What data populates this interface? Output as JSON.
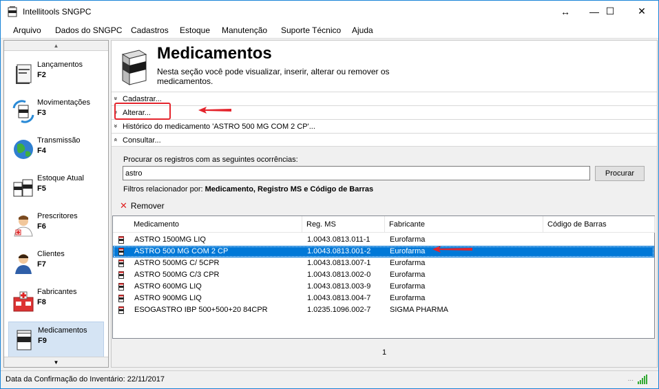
{
  "window": {
    "title": "Intellitools SNGPC",
    "controls": {
      "resize": "↔",
      "minimize": "—",
      "maximize": "☐",
      "close": "✕"
    }
  },
  "menu": [
    "Arquivo",
    "Dados do SNGPC",
    "Cadastros",
    "Estoque",
    "Manutenção",
    "Suporte Técnico",
    "Ajuda"
  ],
  "sidebar": {
    "items": [
      {
        "label": "Lançamentos",
        "key": "F2",
        "icon": "ledger-book-icon"
      },
      {
        "label": "Movimentações",
        "key": "F3",
        "icon": "transfer-arrows-icon"
      },
      {
        "label": "Transmissão",
        "key": "F4",
        "icon": "globe-icon"
      },
      {
        "label": "Estoque Atual",
        "key": "F5",
        "icon": "boxes-icon"
      },
      {
        "label": "Prescritores",
        "key": "F6",
        "icon": "doctor-icon"
      },
      {
        "label": "Clientes",
        "key": "F7",
        "icon": "person-icon"
      },
      {
        "label": "Fabricantes",
        "key": "F8",
        "icon": "factory-icon"
      },
      {
        "label": "Medicamentos",
        "key": "F9",
        "icon": "medicine-box-icon"
      }
    ],
    "scroll_up": "▲",
    "scroll_down": "▼"
  },
  "header": {
    "title": "Medicamentos",
    "description": "Nesta seção você pode visualizar, inserir, alterar ou remover os medicamentos."
  },
  "sections": [
    {
      "label": "Cadastrar...",
      "chevron": "»"
    },
    {
      "label": "Alterar...",
      "chevron": "»"
    },
    {
      "label": "Histórico do medicamento 'ASTRO 500 MG COM 2 CP'...",
      "chevron": "»"
    },
    {
      "label": "Consultar...",
      "chevron": "«"
    }
  ],
  "search": {
    "label": "Procurar os registros com as seguintes ocorrências:",
    "value": "astro",
    "button": "Procurar",
    "filters_prefix": "Filtros relacionador por:",
    "filters_value": "Medicamento, Registro MS e Código de Barras"
  },
  "toolbar": {
    "remove": "Remover"
  },
  "table": {
    "columns": [
      "Medicamento",
      "Reg. MS",
      "Fabricante",
      "Código de Barras"
    ],
    "rows": [
      {
        "medicamento": "ASTRO 1500MG LIQ",
        "reg_ms": "1.0043.0813.011-1",
        "fabricante": "Eurofarma",
        "codigo": ""
      },
      {
        "medicamento": "ASTRO 500 MG COM 2 CP",
        "reg_ms": "1.0043.0813.001-2",
        "fabricante": "Eurofarma",
        "codigo": ""
      },
      {
        "medicamento": "ASTRO 500MG C/ 5CPR",
        "reg_ms": "1.0043.0813.007-1",
        "fabricante": "Eurofarma",
        "codigo": ""
      },
      {
        "medicamento": "ASTRO 500MG C/3 CPR",
        "reg_ms": "1.0043.0813.002-0",
        "fabricante": "Eurofarma",
        "codigo": ""
      },
      {
        "medicamento": "ASTRO 600MG LIQ",
        "reg_ms": "1.0043.0813.003-9",
        "fabricante": "Eurofarma",
        "codigo": ""
      },
      {
        "medicamento": "ASTRO 900MG LIQ",
        "reg_ms": "1.0043.0813.004-7",
        "fabricante": "Eurofarma",
        "codigo": ""
      },
      {
        "medicamento": "ESOGASTRO IBP 500+500+20 84CPR",
        "reg_ms": "1.0235.1096.002-7",
        "fabricante": "SIGMA PHARMA",
        "codigo": ""
      }
    ],
    "selected_index": 1
  },
  "pager": {
    "page": "1"
  },
  "status": {
    "text": "Data da Confirmação do Inventário: 22/11/2017",
    "grip": "..."
  },
  "colors": {
    "selection": "#0078d7",
    "annotation": "#e4242c",
    "accent": "#1883d7"
  }
}
